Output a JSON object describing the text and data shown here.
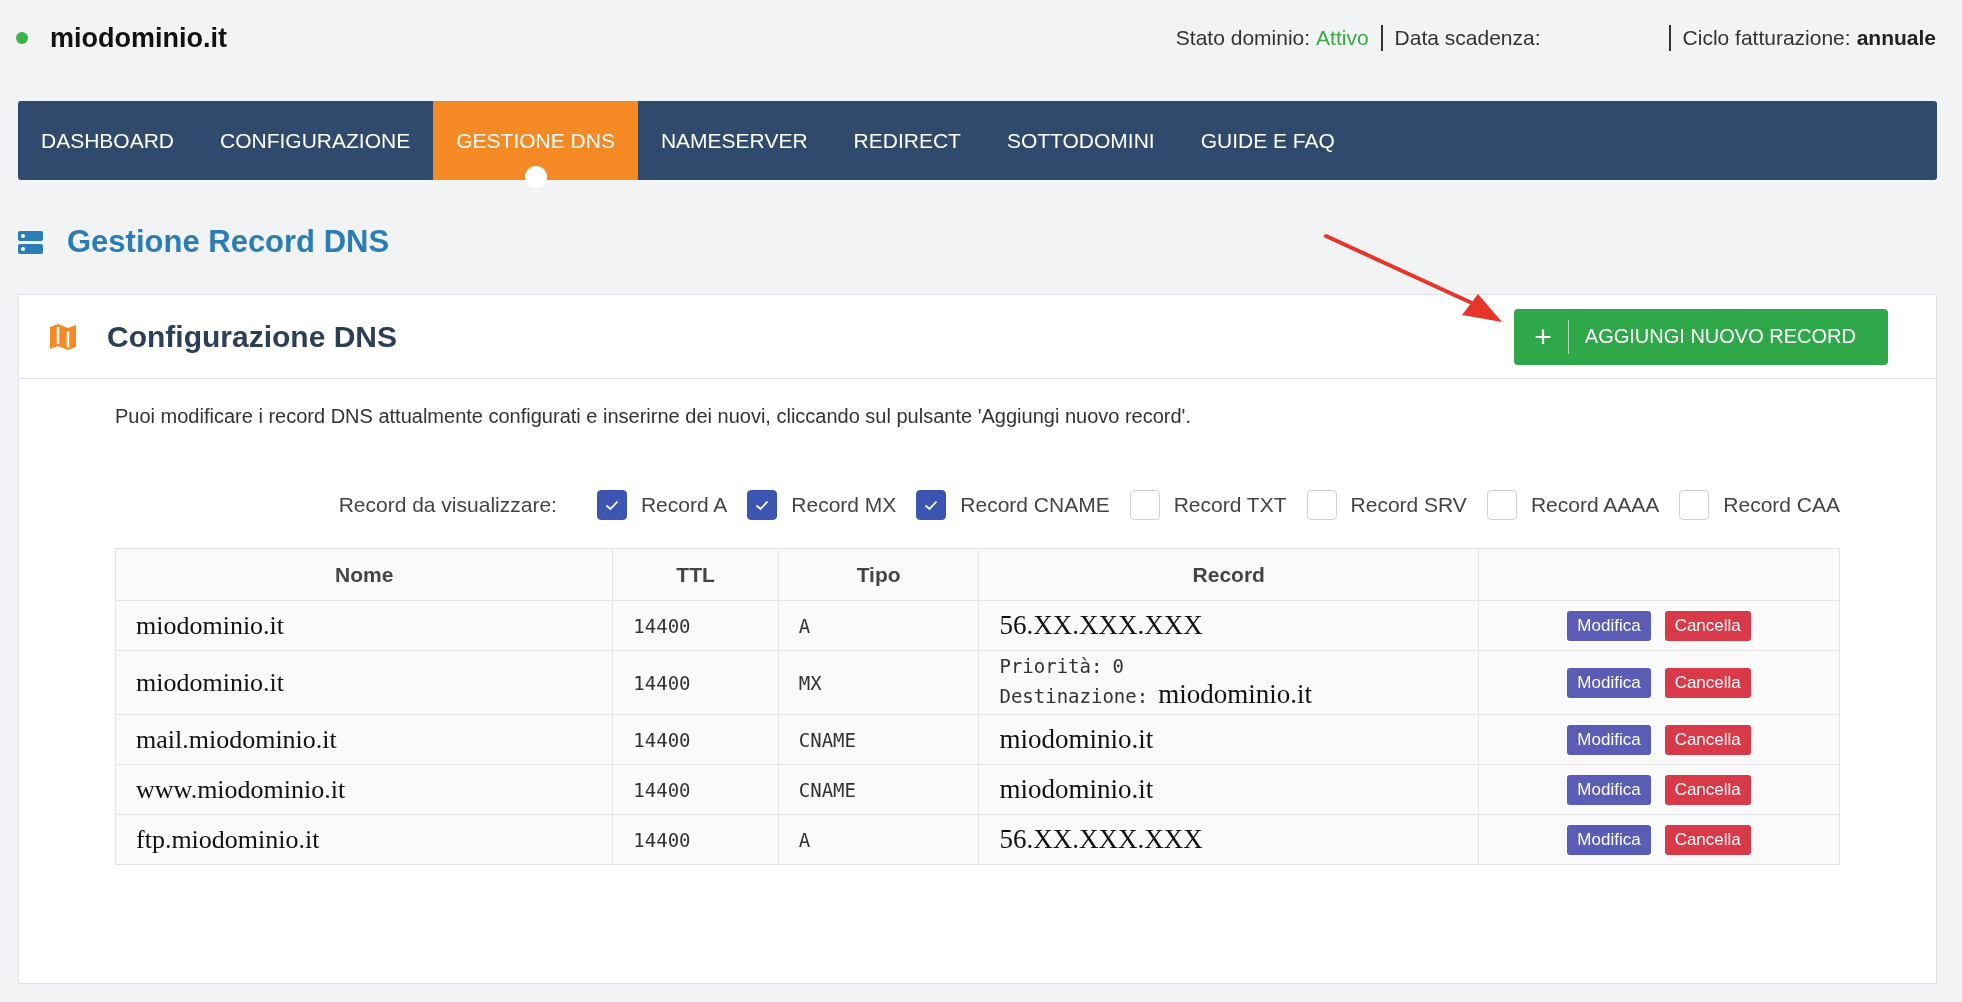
{
  "header": {
    "domain": "miodominio.it",
    "status_items": [
      {
        "label": "Stato dominio:",
        "value": "Attivo",
        "kind": "status"
      },
      {
        "label": "Data scadenza:"
      },
      {
        "label": "Ciclo fatturazione:",
        "value": "annuale",
        "kind": "bold"
      }
    ]
  },
  "tabs": [
    {
      "label": "DASHBOARD",
      "selected": false
    },
    {
      "label": "CONFIGURAZIONE",
      "selected": false
    },
    {
      "label": "GESTIONE DNS",
      "selected": true
    },
    {
      "label": "NAMESERVER",
      "selected": false
    },
    {
      "label": "REDIRECT",
      "selected": false
    },
    {
      "label": "SOTTODOMINI",
      "selected": false
    },
    {
      "label": "GUIDE E FAQ",
      "selected": false
    }
  ],
  "section_title": "Gestione Record DNS",
  "card": {
    "title": "Configurazione DNS",
    "add_button": {
      "icon": "+",
      "label": "AGGIUNGI NUOVO RECORD"
    },
    "description": "Puoi modificare i record DNS attualmente configurati e inserirne dei nuovi, cliccando sul pulsante 'Aggiungi nuovo record'.",
    "filter_label": "Record da visualizzare:",
    "filters": [
      {
        "label": "Record A",
        "checked": true
      },
      {
        "label": "Record MX",
        "checked": true
      },
      {
        "label": "Record CNAME",
        "checked": true
      },
      {
        "label": "Record TXT",
        "checked": false
      },
      {
        "label": "Record SRV",
        "checked": false
      },
      {
        "label": "Record AAAA",
        "checked": false
      },
      {
        "label": "Record CAA",
        "checked": false
      }
    ],
    "table": {
      "columns": [
        "Nome",
        "TTL",
        "Tipo",
        "Record"
      ],
      "rows": [
        {
          "name": "miodominio.it",
          "ttl": "14400",
          "type": "A",
          "record": {
            "kind": "plain",
            "text": "56.XX.XXX.XXX"
          },
          "actions": [
            "Modifica",
            "Cancella"
          ]
        },
        {
          "name": "miodominio.it",
          "ttl": "14400",
          "type": "MX",
          "record": {
            "kind": "mx",
            "priority_label": "Priorità:",
            "priority": "0",
            "destination_label": "Destinazione:",
            "destination": "miodominio.it"
          },
          "actions": [
            "Modifica",
            "Cancella"
          ]
        },
        {
          "name": "mail.miodominio.it",
          "ttl": "14400",
          "type": "CNAME",
          "record": {
            "kind": "plain",
            "text": "miodominio.it"
          },
          "actions": [
            "Modifica",
            "Cancella"
          ]
        },
        {
          "name": "www.miodominio.it",
          "ttl": "14400",
          "type": "CNAME",
          "record": {
            "kind": "plain",
            "text": "miodominio.it"
          },
          "actions": [
            "Modifica",
            "Cancella"
          ]
        },
        {
          "name": "ftp.miodominio.it",
          "ttl": "14400",
          "type": "A",
          "record": {
            "kind": "plain",
            "text": "56.XX.XXX.XXX"
          },
          "actions": [
            "Modifica",
            "Cancella"
          ]
        }
      ]
    }
  }
}
